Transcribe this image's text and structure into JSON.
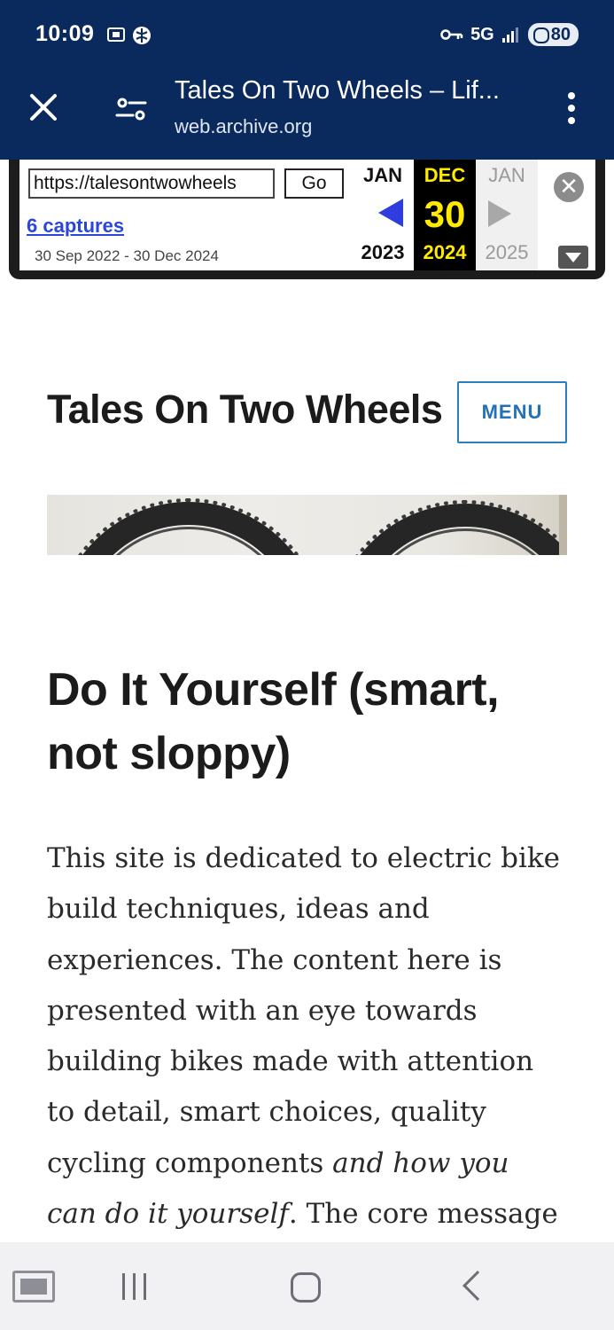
{
  "status_bar": {
    "time": "10:09",
    "network": "5G",
    "battery": "80"
  },
  "toolbar": {
    "title": "Tales On Two Wheels – Lif...",
    "url": "web.archive.org"
  },
  "wayback": {
    "url_value": "https://talesontwowheels",
    "go_label": "Go",
    "captures_link": "6 captures",
    "date_range": "30 Sep 2022 - 30 Dec 2024",
    "prev": {
      "month": "JAN",
      "year": "2023"
    },
    "current": {
      "month": "DEC",
      "day": "30",
      "year": "2024"
    },
    "next": {
      "month": "JAN",
      "year": "2025"
    },
    "close_glyph": "✕"
  },
  "site": {
    "title": "Tales On Two Wheels",
    "menu_label": "MENU"
  },
  "article": {
    "heading_line1": "Do It Yourself (smart,",
    "heading_line2": "not sloppy)",
    "lines": [
      "This site is dedicated to electric bike",
      "build techniques, ideas and",
      "experiences. The content here is",
      "presented with an eye towards",
      "building bikes made with attention",
      "to detail, smart choices, quality"
    ],
    "line7_normal": "cycling components ",
    "line7_italic": "and how you",
    "line8_italic": "can do it yourself",
    "line8_normal": ". The core message"
  },
  "icons": {
    "close": "close-icon",
    "page_info": "tune-icon",
    "more": "more-vert-icon",
    "prev_arrow": "arrow-left-icon",
    "next_arrow": "arrow-right-icon"
  },
  "colors": {
    "header_bg": "#0a2a5e",
    "wayback_prev_arrow": "#2f3cdf",
    "wayback_current_text": "#ffea00",
    "menu_border": "#2a7fbf",
    "captures_link": "#2c47d8"
  }
}
